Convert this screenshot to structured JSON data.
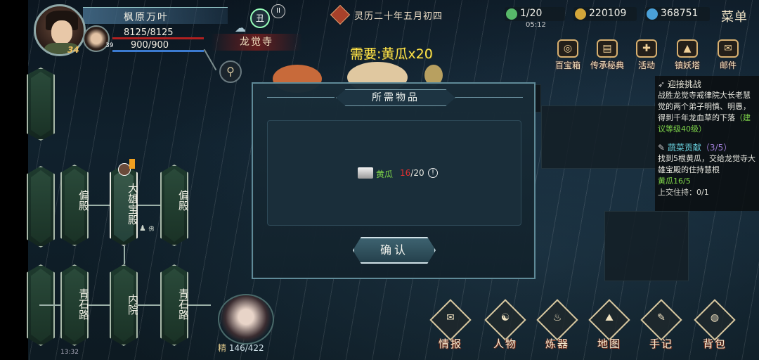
{
  "player": {
    "name": "枫原万叶",
    "level": "34",
    "hp": "8125/8125",
    "mp": "900/900"
  },
  "pet": {
    "level": "39"
  },
  "hour_badge": "丑",
  "pause_symbol": "II",
  "location": "龙觉寺",
  "date": "灵历二十年五月初四",
  "resources": [
    {
      "icon": "jade-icon",
      "value": "1/20",
      "color": "#58b86a"
    },
    {
      "icon": "coin-icon",
      "value": "220109",
      "color": "#d4a73a"
    },
    {
      "icon": "spirit-stone-icon",
      "value": "368751",
      "color": "#4aa0d8"
    }
  ],
  "timer": "05:12",
  "menu_label": "菜单",
  "top_icons": [
    {
      "name": "treasure-box",
      "label": "百宝箱"
    },
    {
      "name": "legacy-classic",
      "label": "传承秘典"
    },
    {
      "name": "activity",
      "label": "活动"
    },
    {
      "name": "demon-tower",
      "label": "镇妖塔"
    },
    {
      "name": "mail",
      "label": "邮件"
    }
  ],
  "need_label": "需要:黄瓜x20",
  "quest_panel": {
    "challenge_title": "迎接挑战",
    "challenge_desc": "战胜龙觉寺戒律院大长老慧觉的两个弟子明慎、明愚，得到千年龙血草的下落",
    "challenge_level": "（建议等级40级）",
    "veg_title": "蔬菜贡献",
    "veg_progress": "（3/5）",
    "veg_desc": "找到5根黄瓜，交给龙觉寺大雄宝殿的住持慧根",
    "cucumber_progress": "黄瓜16/5",
    "submit_progress": "上交住持：0/1"
  },
  "map_nodes": {
    "side_hall_left": "偏殿",
    "main_hall": "大雄宝殿",
    "side_hall_right": "偏殿",
    "stone_road_left": "青石路",
    "inner_court": "内院",
    "stone_road_right": "青石路"
  },
  "npc_marker_label": "佛",
  "spirit": {
    "label": "精",
    "value": "146/422"
  },
  "status_time": "13:32",
  "bottom_menu": [
    {
      "name": "info",
      "label": "情报",
      "glyph": "✉"
    },
    {
      "name": "characters",
      "label": "人物",
      "glyph": "☯"
    },
    {
      "name": "alchemy",
      "label": "炼器",
      "glyph": "♨"
    },
    {
      "name": "map",
      "label": "地图",
      "glyph": "⛰"
    },
    {
      "name": "notes",
      "label": "手记",
      "glyph": "✎"
    },
    {
      "name": "bag",
      "label": "背包",
      "glyph": "◍"
    }
  ],
  "dialog": {
    "title": "所需物品",
    "item_name": "黄瓜",
    "item_have": "16",
    "item_need": "/20",
    "info_symbol": "!",
    "confirm_label": "确认"
  }
}
